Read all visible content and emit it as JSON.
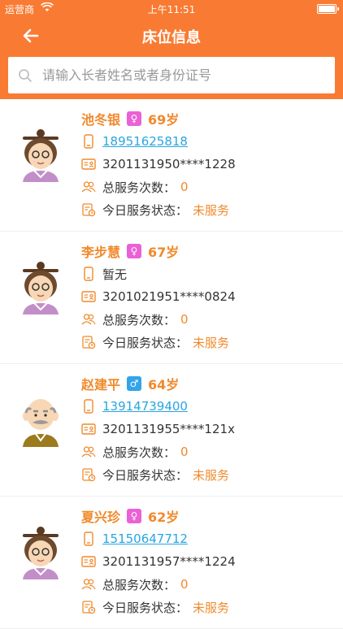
{
  "status_bar": {
    "carrier": "运营商",
    "time": "上午11:51"
  },
  "nav": {
    "title": "床位信息"
  },
  "search": {
    "placeholder": "请输入长者姓名或者身份证号"
  },
  "labels": {
    "service_count": "总服务次数：",
    "service_status": "今日服务状态："
  },
  "residents": [
    {
      "name": "池冬银",
      "gender": "female",
      "age": "69岁",
      "phone": "18951625818",
      "id_number": "3201131950****1228",
      "count": "0",
      "status": "未服务"
    },
    {
      "name": "李步慧",
      "gender": "female",
      "age": "67岁",
      "phone": "暂无",
      "id_number": "3201021951****0824",
      "count": "0",
      "status": "未服务"
    },
    {
      "name": "赵建平",
      "gender": "male",
      "age": "64岁",
      "phone": "13914739400",
      "id_number": "3201131955****121x",
      "count": "0",
      "status": "未服务"
    },
    {
      "name": "夏兴珍",
      "gender": "female",
      "age": "62岁",
      "phone": "15150647712",
      "id_number": "3201131957****1224",
      "count": "0",
      "status": "未服务"
    }
  ],
  "colors": {
    "header": "#f97b33",
    "accent": "#f08a2b",
    "link": "#28a6e0",
    "female": "#ea61d6",
    "male": "#33a4e8"
  }
}
